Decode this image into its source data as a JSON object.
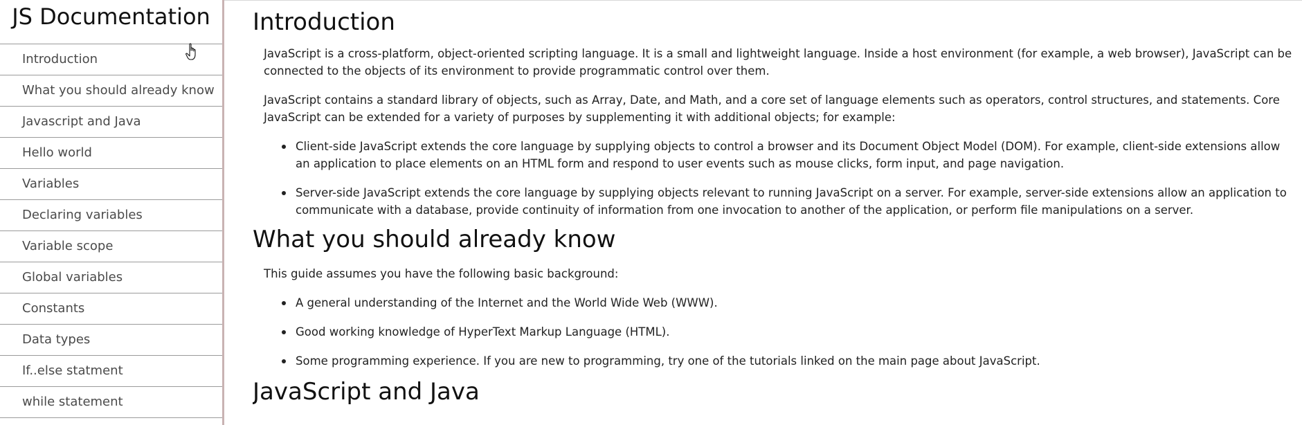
{
  "sidebar": {
    "title": "JS Documentation",
    "items": [
      {
        "label": "Introduction"
      },
      {
        "label": "What you should already know"
      },
      {
        "label": "Javascript and Java"
      },
      {
        "label": "Hello world"
      },
      {
        "label": "Variables"
      },
      {
        "label": "Declaring variables"
      },
      {
        "label": "Variable scope"
      },
      {
        "label": "Global variables"
      },
      {
        "label": "Constants"
      },
      {
        "label": "Data types"
      },
      {
        "label": "If..else statment"
      },
      {
        "label": "while statement"
      }
    ]
  },
  "main": {
    "introduction": {
      "title": "Introduction",
      "p1": "JavaScript is a cross-platform, object-oriented scripting language. It is a small and lightweight language. Inside a host environment (for example, a web browser), JavaScript can be connected to the objects of its environment to provide programmatic control over them.",
      "p2": "JavaScript contains a standard library of objects, such as Array, Date, and Math, and a core set of language elements such as operators, control structures, and statements. Core JavaScript can be extended for a variety of purposes by supplementing it with additional objects; for example:",
      "bullets": [
        "Client-side JavaScript extends the core language by supplying objects to control a browser and its Document Object Model (DOM). For example, client-side extensions allow an application to place elements on an HTML form and respond to user events such as mouse clicks, form input, and page navigation.",
        "Server-side JavaScript extends the core language by supplying objects relevant to running JavaScript on a server. For example, server-side extensions allow an application to communicate with a database, provide continuity of information from one invocation to another of the application, or perform file manipulations on a server."
      ]
    },
    "already_know": {
      "title": "What you should already know",
      "p1": "This guide assumes you have the following basic background:",
      "bullets": [
        "A general understanding of the Internet and the World Wide Web (WWW).",
        "Good working knowledge of HyperText Markup Language (HTML).",
        "Some programming experience. If you are new to programming, try one of the tutorials linked on the main page about JavaScript."
      ]
    },
    "js_and_java": {
      "title": "JavaScript and Java"
    }
  }
}
